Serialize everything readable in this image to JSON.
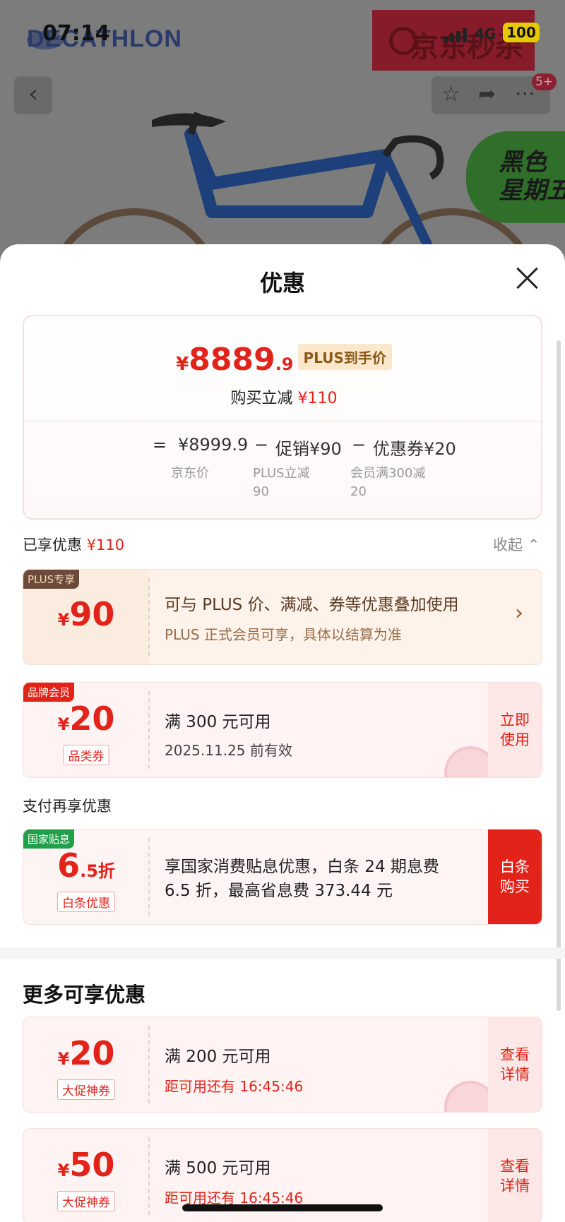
{
  "status_bar": {
    "time": "07:14",
    "network": "4G",
    "battery": "100"
  },
  "product_page": {
    "brand": "DECATHLON",
    "seckill_label": "京东秒杀",
    "notification_badge": "5+",
    "black_friday_line1": "黑色",
    "black_friday_line2": "星期五"
  },
  "sheet": {
    "title": "优惠",
    "price_summary": {
      "currency": "¥",
      "price_main": "8889",
      "price_decimal": ".9",
      "price_tag": "PLUS到手价",
      "reduce_label": "购买立减",
      "reduce_amount": "¥110",
      "equals": "=",
      "jd_price": "¥8999.9",
      "jd_price_label": "京东价",
      "minus": "−",
      "promo": "促销¥90",
      "promo_sub_line1": "PLUS立减",
      "promo_sub_line2": "90",
      "coupon": "优惠券¥20",
      "coupon_sub_line1": "会员满300减",
      "coupon_sub_line2": "20"
    },
    "enjoyed": {
      "label": "已享优惠",
      "amount": "¥110",
      "collapse": "收起"
    },
    "plus_coupon": {
      "corner": "PLUS专享",
      "currency": "¥",
      "amount": "90",
      "line1": "可与 PLUS 价、满减、券等优惠叠加使用",
      "line2": "PLUS 正式会员可享，具体以结算为准"
    },
    "brand_coupon": {
      "corner": "品牌会员",
      "currency": "¥",
      "amount": "20",
      "kind": "品类券",
      "line1": "满 300 元可用",
      "line2": "2025.11.25 前有效",
      "action": "立即使用"
    },
    "pay_section_title": "支付再享优惠",
    "gov_coupon": {
      "corner": "国家贴息",
      "amount": "6",
      "amount_small": ".5",
      "unit": "折",
      "kind": "白条优惠",
      "line1": "享国家消费贴息优惠，白条 24 期息费 6.5 折，最高省息费 373.44 元",
      "action": "白条购买"
    },
    "more_title": "更多可享优惠",
    "more_coupons": [
      {
        "currency": "¥",
        "amount": "20",
        "kind": "大促神券",
        "line1": "满 200 元可用",
        "line2": "距可用还有 16:45:46",
        "action": "查看详情"
      },
      {
        "currency": "¥",
        "amount": "50",
        "kind": "大促神券",
        "line1": "满 500 元可用",
        "line2": "距可用还有 16:45:46",
        "action": "查看详情"
      }
    ]
  }
}
